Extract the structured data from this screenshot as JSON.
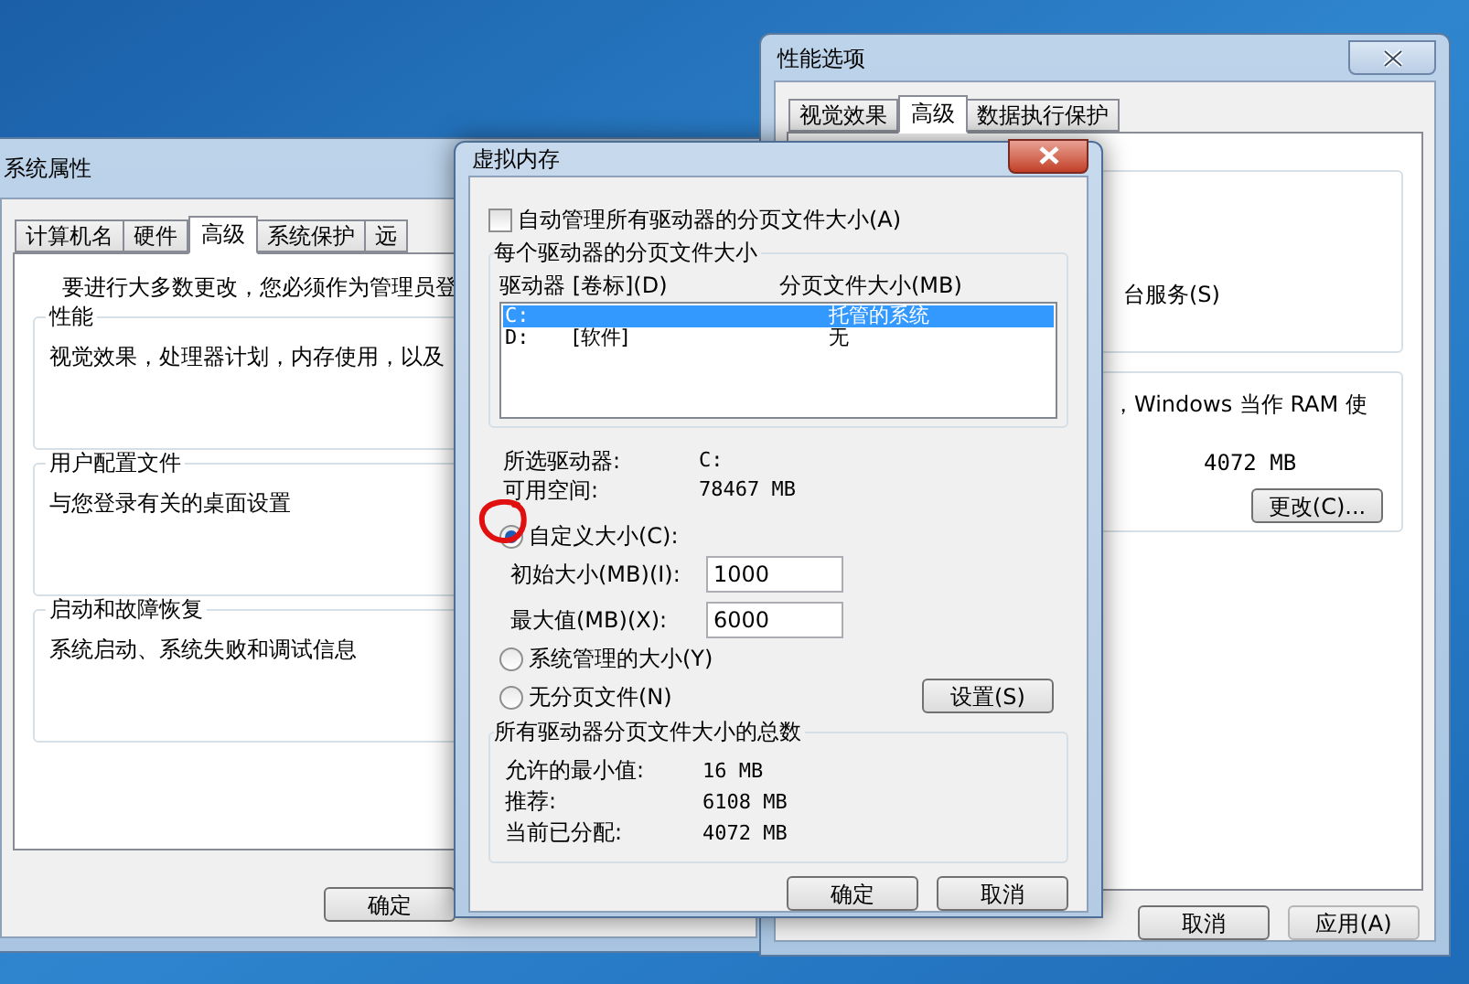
{
  "system_properties": {
    "title": "系统属性",
    "tabs": [
      {
        "label": "计算机名",
        "selected": false
      },
      {
        "label": "硬件",
        "selected": false
      },
      {
        "label": "高级",
        "selected": true
      },
      {
        "label": "系统保护",
        "selected": false
      },
      {
        "label": "远",
        "selected": false
      }
    ],
    "notice": "要进行大多数更改，您必须作为管理员登",
    "groups": [
      {
        "title": "性能",
        "text": "视觉效果，处理器计划，内存使用，以及"
      },
      {
        "title": "用户配置文件",
        "text": "与您登录有关的桌面设置"
      },
      {
        "title": "启动和故障恢复",
        "text": "系统启动、系统失败和调试信息"
      }
    ],
    "buttons": [
      "确定"
    ]
  },
  "performance_options": {
    "title": "性能选项",
    "tabs": [
      {
        "label": "视觉效果",
        "selected": false
      },
      {
        "label": "高级",
        "selected": true
      },
      {
        "label": "数据执行保护",
        "selected": false
      }
    ],
    "group_1_text": "台服务(S)",
    "group_2_text": "，Windows 当作 RAM 使",
    "group_2_value": "4072 MB",
    "change_button": "更改(C)...",
    "buttons": [
      {
        "label": "取消",
        "disabled": false
      },
      {
        "label": "应用(A)",
        "disabled": true
      }
    ]
  },
  "virtual_memory": {
    "title": "虚拟内存",
    "auto_manage": {
      "label": "自动管理所有驱动器的分页文件大小(A)",
      "checked": false
    },
    "drives_group": {
      "title": "每个驱动器的分页文件大小",
      "columns": [
        "驱动器 [卷标](D)",
        "分页文件大小(MB)"
      ],
      "rows": [
        {
          "drive": "C:",
          "size": "托管的系统",
          "selected": true
        },
        {
          "drive": "D:",
          "volume": "[软件]",
          "size": "无",
          "selected": false
        }
      ]
    },
    "info": [
      {
        "label": "所选驱动器:",
        "value": "C:"
      },
      {
        "label": "可用空间:",
        "value": "78467 MB"
      }
    ],
    "custom_size": {
      "label": "自定义大小(C):",
      "selected": true
    },
    "fields": [
      {
        "label": "初始大小(MB)(I):",
        "value": "1000"
      },
      {
        "label": "最大值(MB)(X):",
        "value": "6000"
      }
    ],
    "other_options": [
      {
        "label": "系统管理的大小(Y)",
        "selected": false
      },
      {
        "label": "无分页文件(N)",
        "selected": false
      }
    ],
    "set_button": "设置(S)",
    "totals_group": {
      "title": "所有驱动器分页文件大小的总数",
      "rows": [
        {
          "label": "允许的最小值:",
          "value": "16 MB"
        },
        {
          "label": "推荐:",
          "value": "6108 MB"
        },
        {
          "label": "当前已分配:",
          "value": "4072 MB"
        }
      ]
    },
    "buttons": [
      "确定",
      "取消"
    ]
  }
}
